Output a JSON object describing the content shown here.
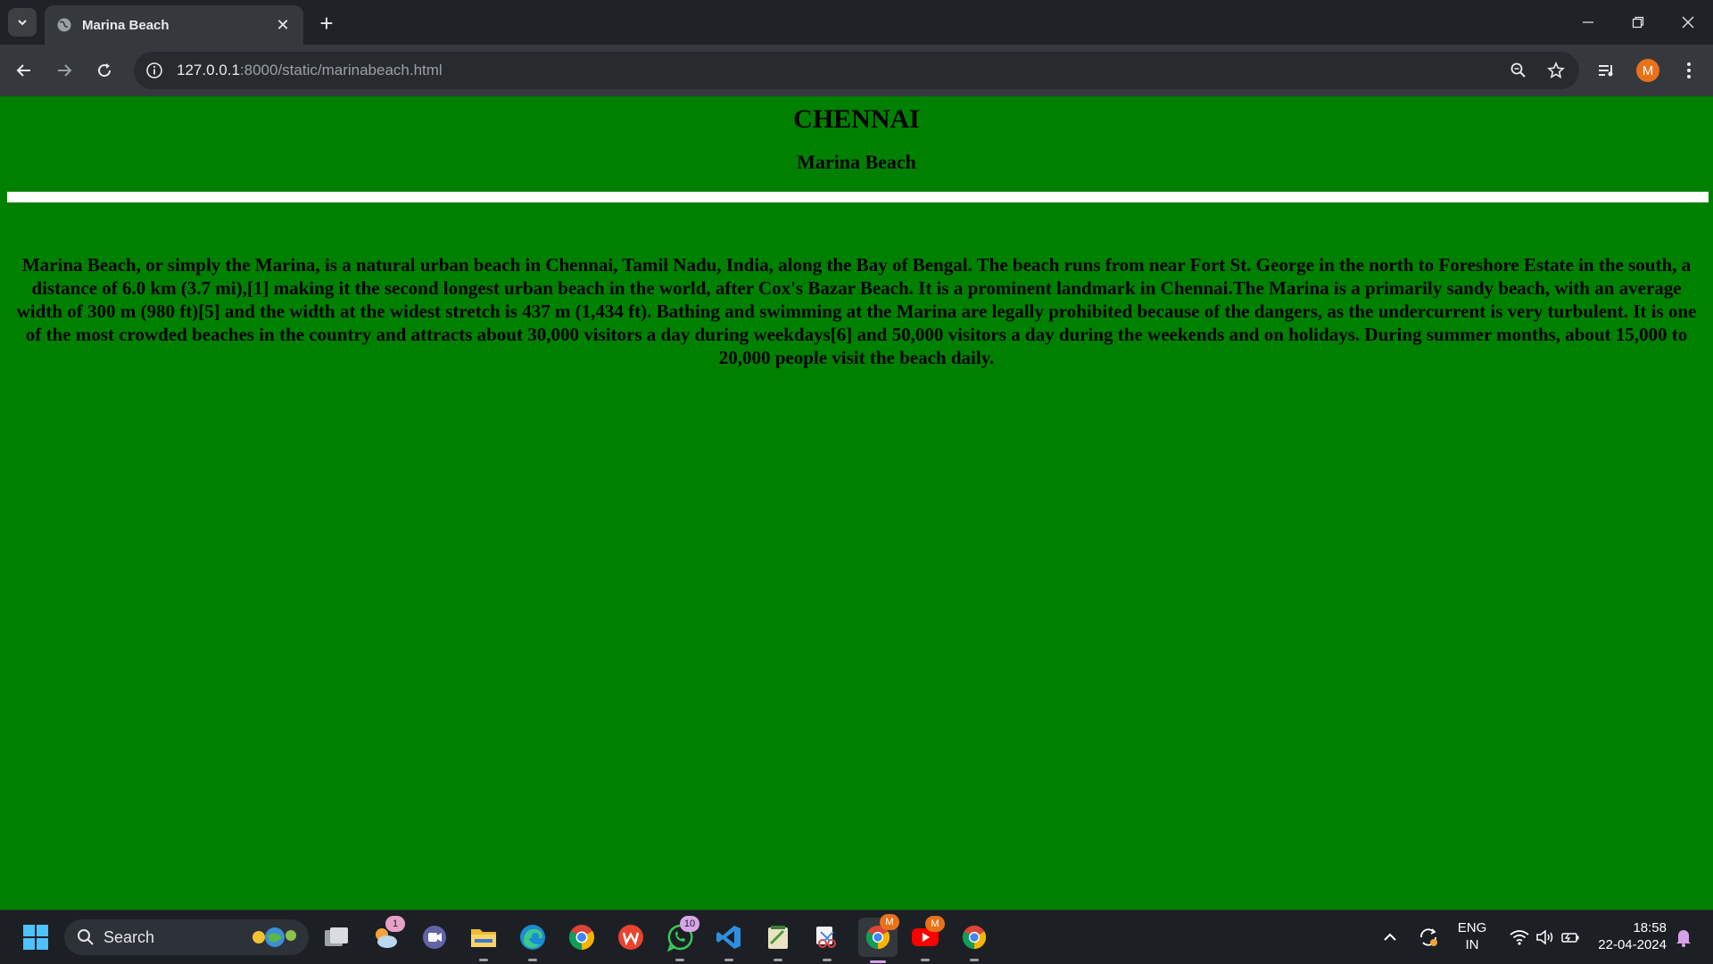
{
  "browser": {
    "tab_title": "Marina Beach",
    "url_host": "127.0.0.1",
    "url_path": ":8000/static/marinabeach.html",
    "profile_initial": "M"
  },
  "page": {
    "background": "#008000",
    "heading": "CHENNAI",
    "subheading": "Marina Beach",
    "paragraph": "Marina Beach, or simply the Marina, is a natural urban beach in Chennai, Tamil Nadu, India, along the Bay of Bengal. The beach runs from near Fort St. George in the north to Foreshore Estate in the south, a distance of 6.0 km (3.7 mi),[1] making it the second longest urban beach in the world, after Cox's Bazar Beach. It is a prominent landmark in Chennai.The Marina is a primarily sandy beach, with an average width of 300 m (980 ft)[5] and the width at the widest stretch is 437 m (1,434 ft). Bathing and swimming at the Marina are legally prohibited because of the dangers, as the undercurrent is very turbulent. It is one of the most crowded beaches in the country and attracts about 30,000 visitors a day during weekdays[6] and 50,000 visitors a day during the weekends and on holidays. During summer months, about 15,000 to 20,000 people visit the beach daily."
  },
  "taskbar": {
    "search_label": "Search",
    "weather_badge": "1",
    "whatsapp_badge": "10",
    "chrome_badge": "M",
    "youtube_badge": "M",
    "language_line1": "ENG",
    "language_line2": "IN",
    "time": "18:58",
    "date": "22-04-2024"
  }
}
